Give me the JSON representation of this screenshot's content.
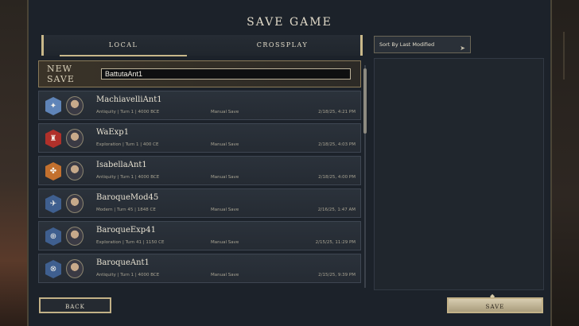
{
  "title": "SAVE GAME",
  "tabs": {
    "local": "LOCAL",
    "crossplay": "CROSSPLAY"
  },
  "new_save": {
    "label": "NEW SAVE",
    "value": "BattutaAnt1"
  },
  "sort": {
    "label": "Sort By Last Modified"
  },
  "saves": [
    {
      "name": "MachiavelliAnt1",
      "meta": "Antiquity | Turn 1 | 4000 BCE",
      "type": "Manual Save",
      "date": "2/18/25, 4:21 PM",
      "crest_color": "#5f84b8",
      "crest_glyph": "✦"
    },
    {
      "name": "WaExp1",
      "meta": "Exploration | Turn 1 | 400 CE",
      "type": "Manual Save",
      "date": "2/18/25, 4:03 PM",
      "crest_color": "#b0302a",
      "crest_glyph": "♜"
    },
    {
      "name": "IsabellaAnt1",
      "meta": "Antiquity | Turn 1 | 4000 BCE",
      "type": "Manual Save",
      "date": "2/18/25, 4:00 PM",
      "crest_color": "#c3702e",
      "crest_glyph": "✤"
    },
    {
      "name": "BaroqueMod45",
      "meta": "Modern | Turn 45 | 1848 CE",
      "type": "Manual Save",
      "date": "2/16/25, 1:47 AM",
      "crest_color": "#3f5f8f",
      "crest_glyph": "✈"
    },
    {
      "name": "BaroqueExp41",
      "meta": "Exploration | Turn 41 | 1150 CE",
      "type": "Manual Save",
      "date": "2/15/25, 11:29 PM",
      "crest_color": "#3f5f8f",
      "crest_glyph": "⊕"
    },
    {
      "name": "BaroqueAnt1",
      "meta": "Antiquity | Turn 1 | 4000 BCE",
      "type": "Manual Save",
      "date": "2/15/25, 9:39 PM",
      "crest_color": "#3f5f8f",
      "crest_glyph": "⊗"
    }
  ],
  "buttons": {
    "back": "BACK",
    "save": "SAVE"
  }
}
